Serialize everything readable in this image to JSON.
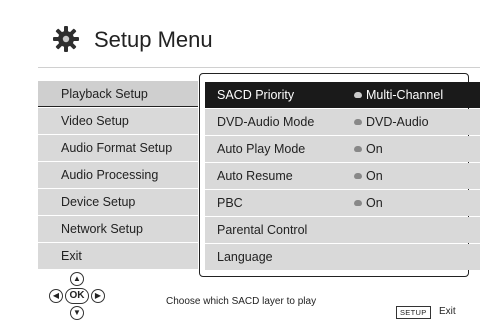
{
  "header": {
    "title": "Setup Menu",
    "icon": "gear-icon"
  },
  "sidebar": {
    "items": [
      {
        "label": "Playback Setup",
        "selected": true
      },
      {
        "label": "Video Setup",
        "selected": false
      },
      {
        "label": "Audio Format Setup",
        "selected": false
      },
      {
        "label": "Audio Processing",
        "selected": false
      },
      {
        "label": "Device Setup",
        "selected": false
      },
      {
        "label": "Network Setup",
        "selected": false
      },
      {
        "label": "Exit",
        "selected": false
      }
    ]
  },
  "options": {
    "items": [
      {
        "label": "SACD Priority",
        "value": "Multi-Channel",
        "selected": true
      },
      {
        "label": "DVD-Audio Mode",
        "value": "DVD-Audio",
        "selected": false
      },
      {
        "label": "Auto Play Mode",
        "value": "On",
        "selected": false
      },
      {
        "label": "Auto Resume",
        "value": "On",
        "selected": false
      },
      {
        "label": "PBC",
        "value": "On",
        "selected": false
      },
      {
        "label": "Parental Control",
        "value": "",
        "selected": false
      },
      {
        "label": "Language",
        "value": "",
        "selected": false
      }
    ]
  },
  "footer": {
    "hint": "Choose which SACD layer to play",
    "ok_label": "OK",
    "setup_key": "SETUP",
    "exit_label": "Exit"
  },
  "colors": {
    "highlight": "#1a1a1a",
    "row": "#d9d9d9",
    "background": "#ffffff"
  }
}
